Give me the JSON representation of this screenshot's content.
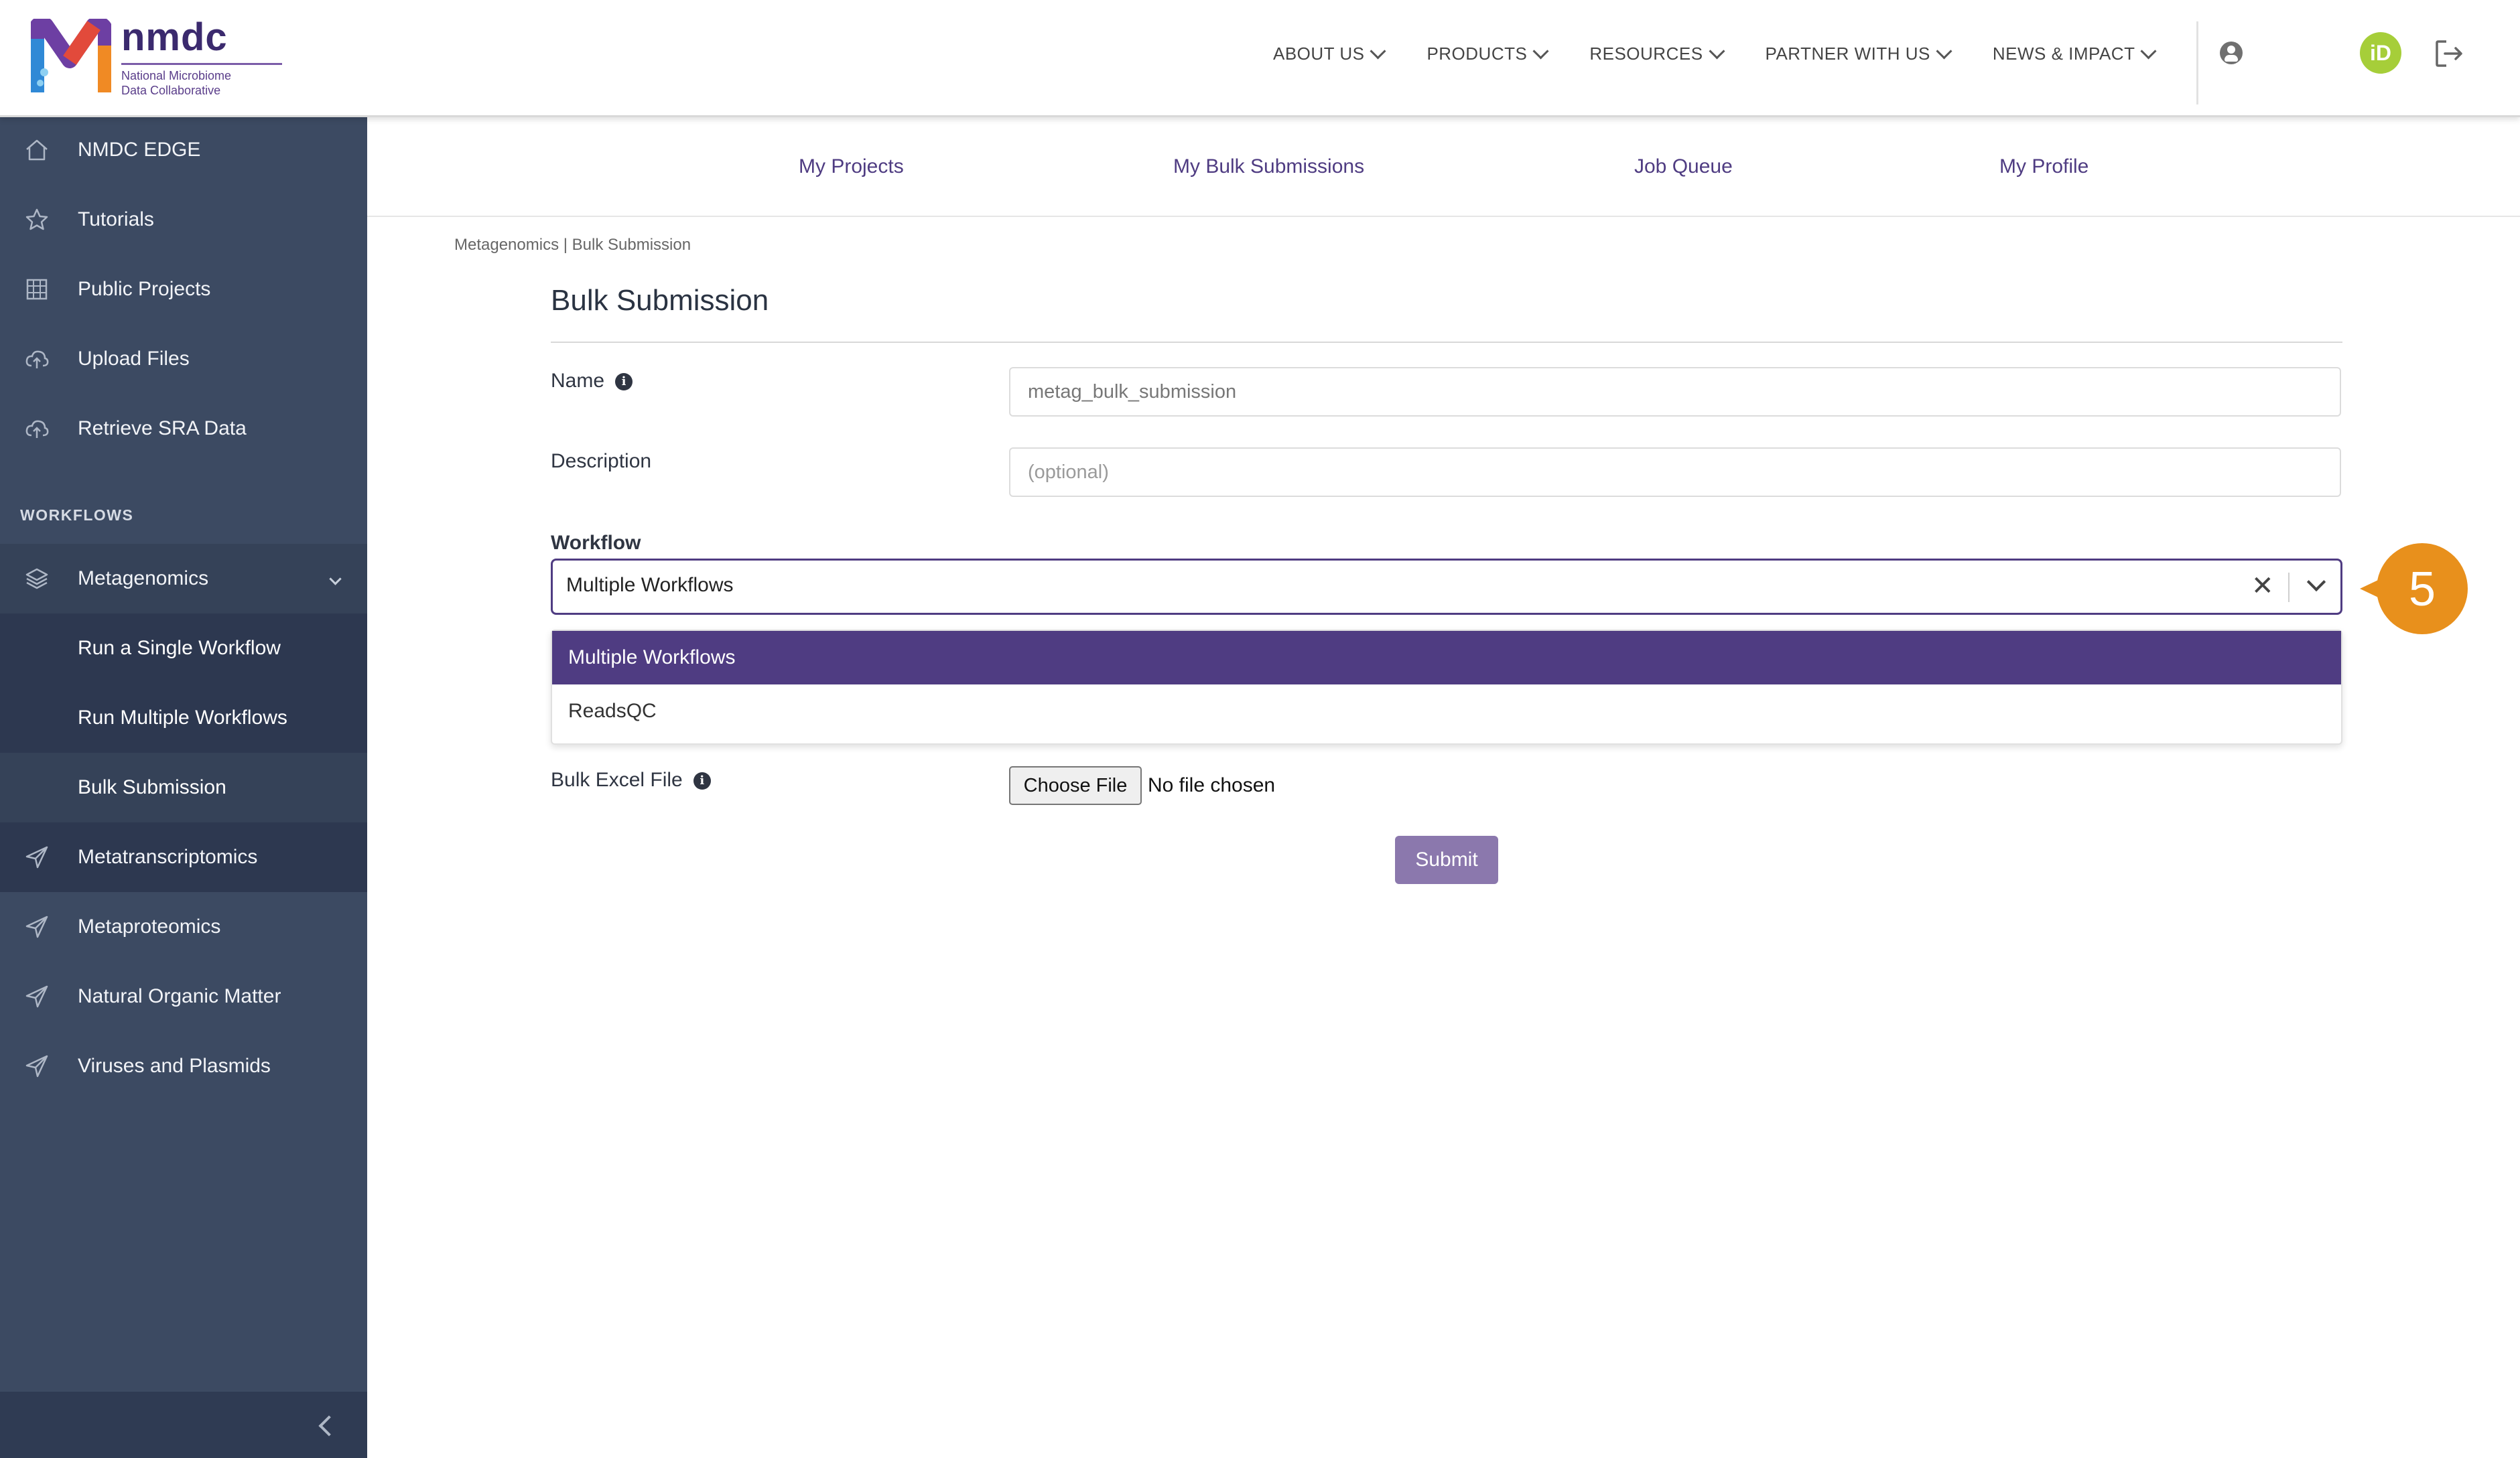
{
  "header": {
    "logo_word": "nmdc",
    "logo_line1": "National Microbiome",
    "logo_line2": "Data Collaborative",
    "nav": [
      "ABOUT US",
      "PRODUCTS",
      "RESOURCES",
      "PARTNER WITH US",
      "NEWS & IMPACT"
    ],
    "orcid_label": "iD"
  },
  "sidebar": {
    "items": [
      {
        "label": "NMDC EDGE",
        "icon": "home-icon"
      },
      {
        "label": "Tutorials",
        "icon": "star-icon"
      },
      {
        "label": "Public Projects",
        "icon": "grid-icon"
      },
      {
        "label": "Upload Files",
        "icon": "cloud-upload-icon"
      },
      {
        "label": "Retrieve SRA Data",
        "icon": "cloud-upload-icon"
      }
    ],
    "section_label": "WORKFLOWS",
    "workflow_group": "Metagenomics",
    "sub_items": [
      "Run a Single Workflow",
      "Run Multiple Workflows",
      "Bulk Submission"
    ],
    "workflows": [
      "Metatranscriptomics",
      "Metaproteomics",
      "Natural Organic Matter",
      "Viruses and Plasmids"
    ]
  },
  "subnav": [
    "My Projects",
    "My Bulk Submissions",
    "Job Queue",
    "My Profile"
  ],
  "main": {
    "breadcrumb": "Metagenomics | Bulk Submission",
    "title": "Bulk Submission",
    "name_label": "Name",
    "name_value": "metag_bulk_submission",
    "description_label": "Description",
    "description_placeholder": "(optional)",
    "workflow_label": "Workflow",
    "workflow_value": "Multiple Workflows",
    "workflow_options": [
      "Multiple Workflows",
      "ReadsQC"
    ],
    "bulk_file_label": "Bulk Excel File",
    "choose_file_label": "Choose File",
    "no_file_text": "No file chosen",
    "submit_label": "Submit",
    "info_glyph": "i"
  },
  "callout": {
    "number": "5",
    "color": "#e8901c"
  },
  "colors": {
    "sidebar": "#3c4a62",
    "accent": "#4f3c82",
    "submit": "#8b78ad",
    "orcid": "#a6ce39"
  }
}
